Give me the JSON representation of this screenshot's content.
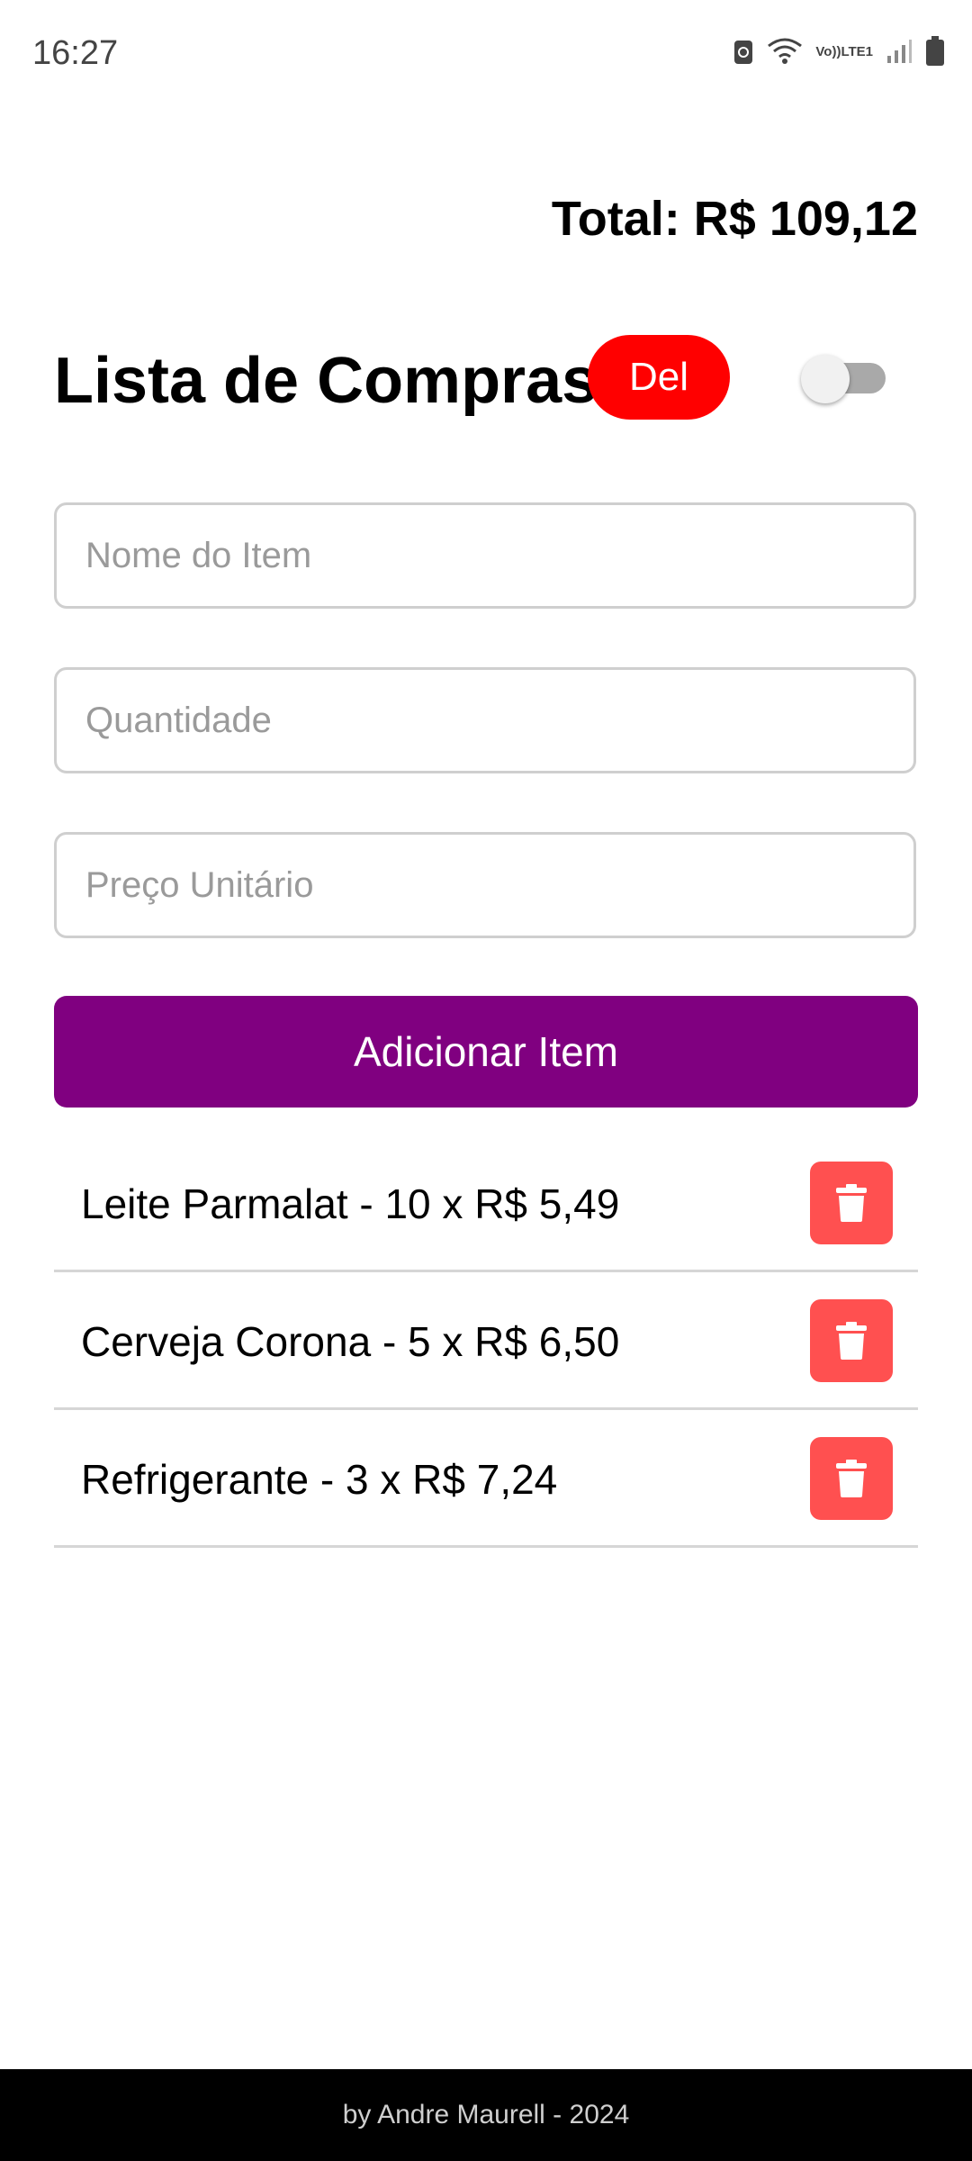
{
  "status_bar": {
    "time": "16:27",
    "network_label_top": "Vo))",
    "network_label_bottom": "LTE1",
    "icons": [
      "vpn-lock-icon",
      "wifi-icon",
      "signal-icon",
      "battery-icon"
    ]
  },
  "header": {
    "total": "Total: R$ 109,12",
    "title": "Lista de Compras",
    "del_label": "Del",
    "toggle_on": false
  },
  "form": {
    "name_placeholder": "Nome do Item",
    "quantity_placeholder": "Quantidade",
    "price_placeholder": "Preço Unitário",
    "add_button_label": "Adicionar Item"
  },
  "items": [
    {
      "label": "Leite Parmalat - 10 x R$ 5,49",
      "icon": "trash-icon"
    },
    {
      "label": "Cerveja Corona - 5 x R$ 6,50",
      "icon": "trash-icon"
    },
    {
      "label": "Refrigerante - 3 x R$ 7,24",
      "icon": "trash-icon"
    }
  ],
  "footer": {
    "text": "by Andre Maurell - 2024"
  },
  "colors": {
    "del_button": "#ff0000",
    "add_button": "#800080",
    "trash_button": "#ff5050",
    "footer_bg": "#000000"
  }
}
